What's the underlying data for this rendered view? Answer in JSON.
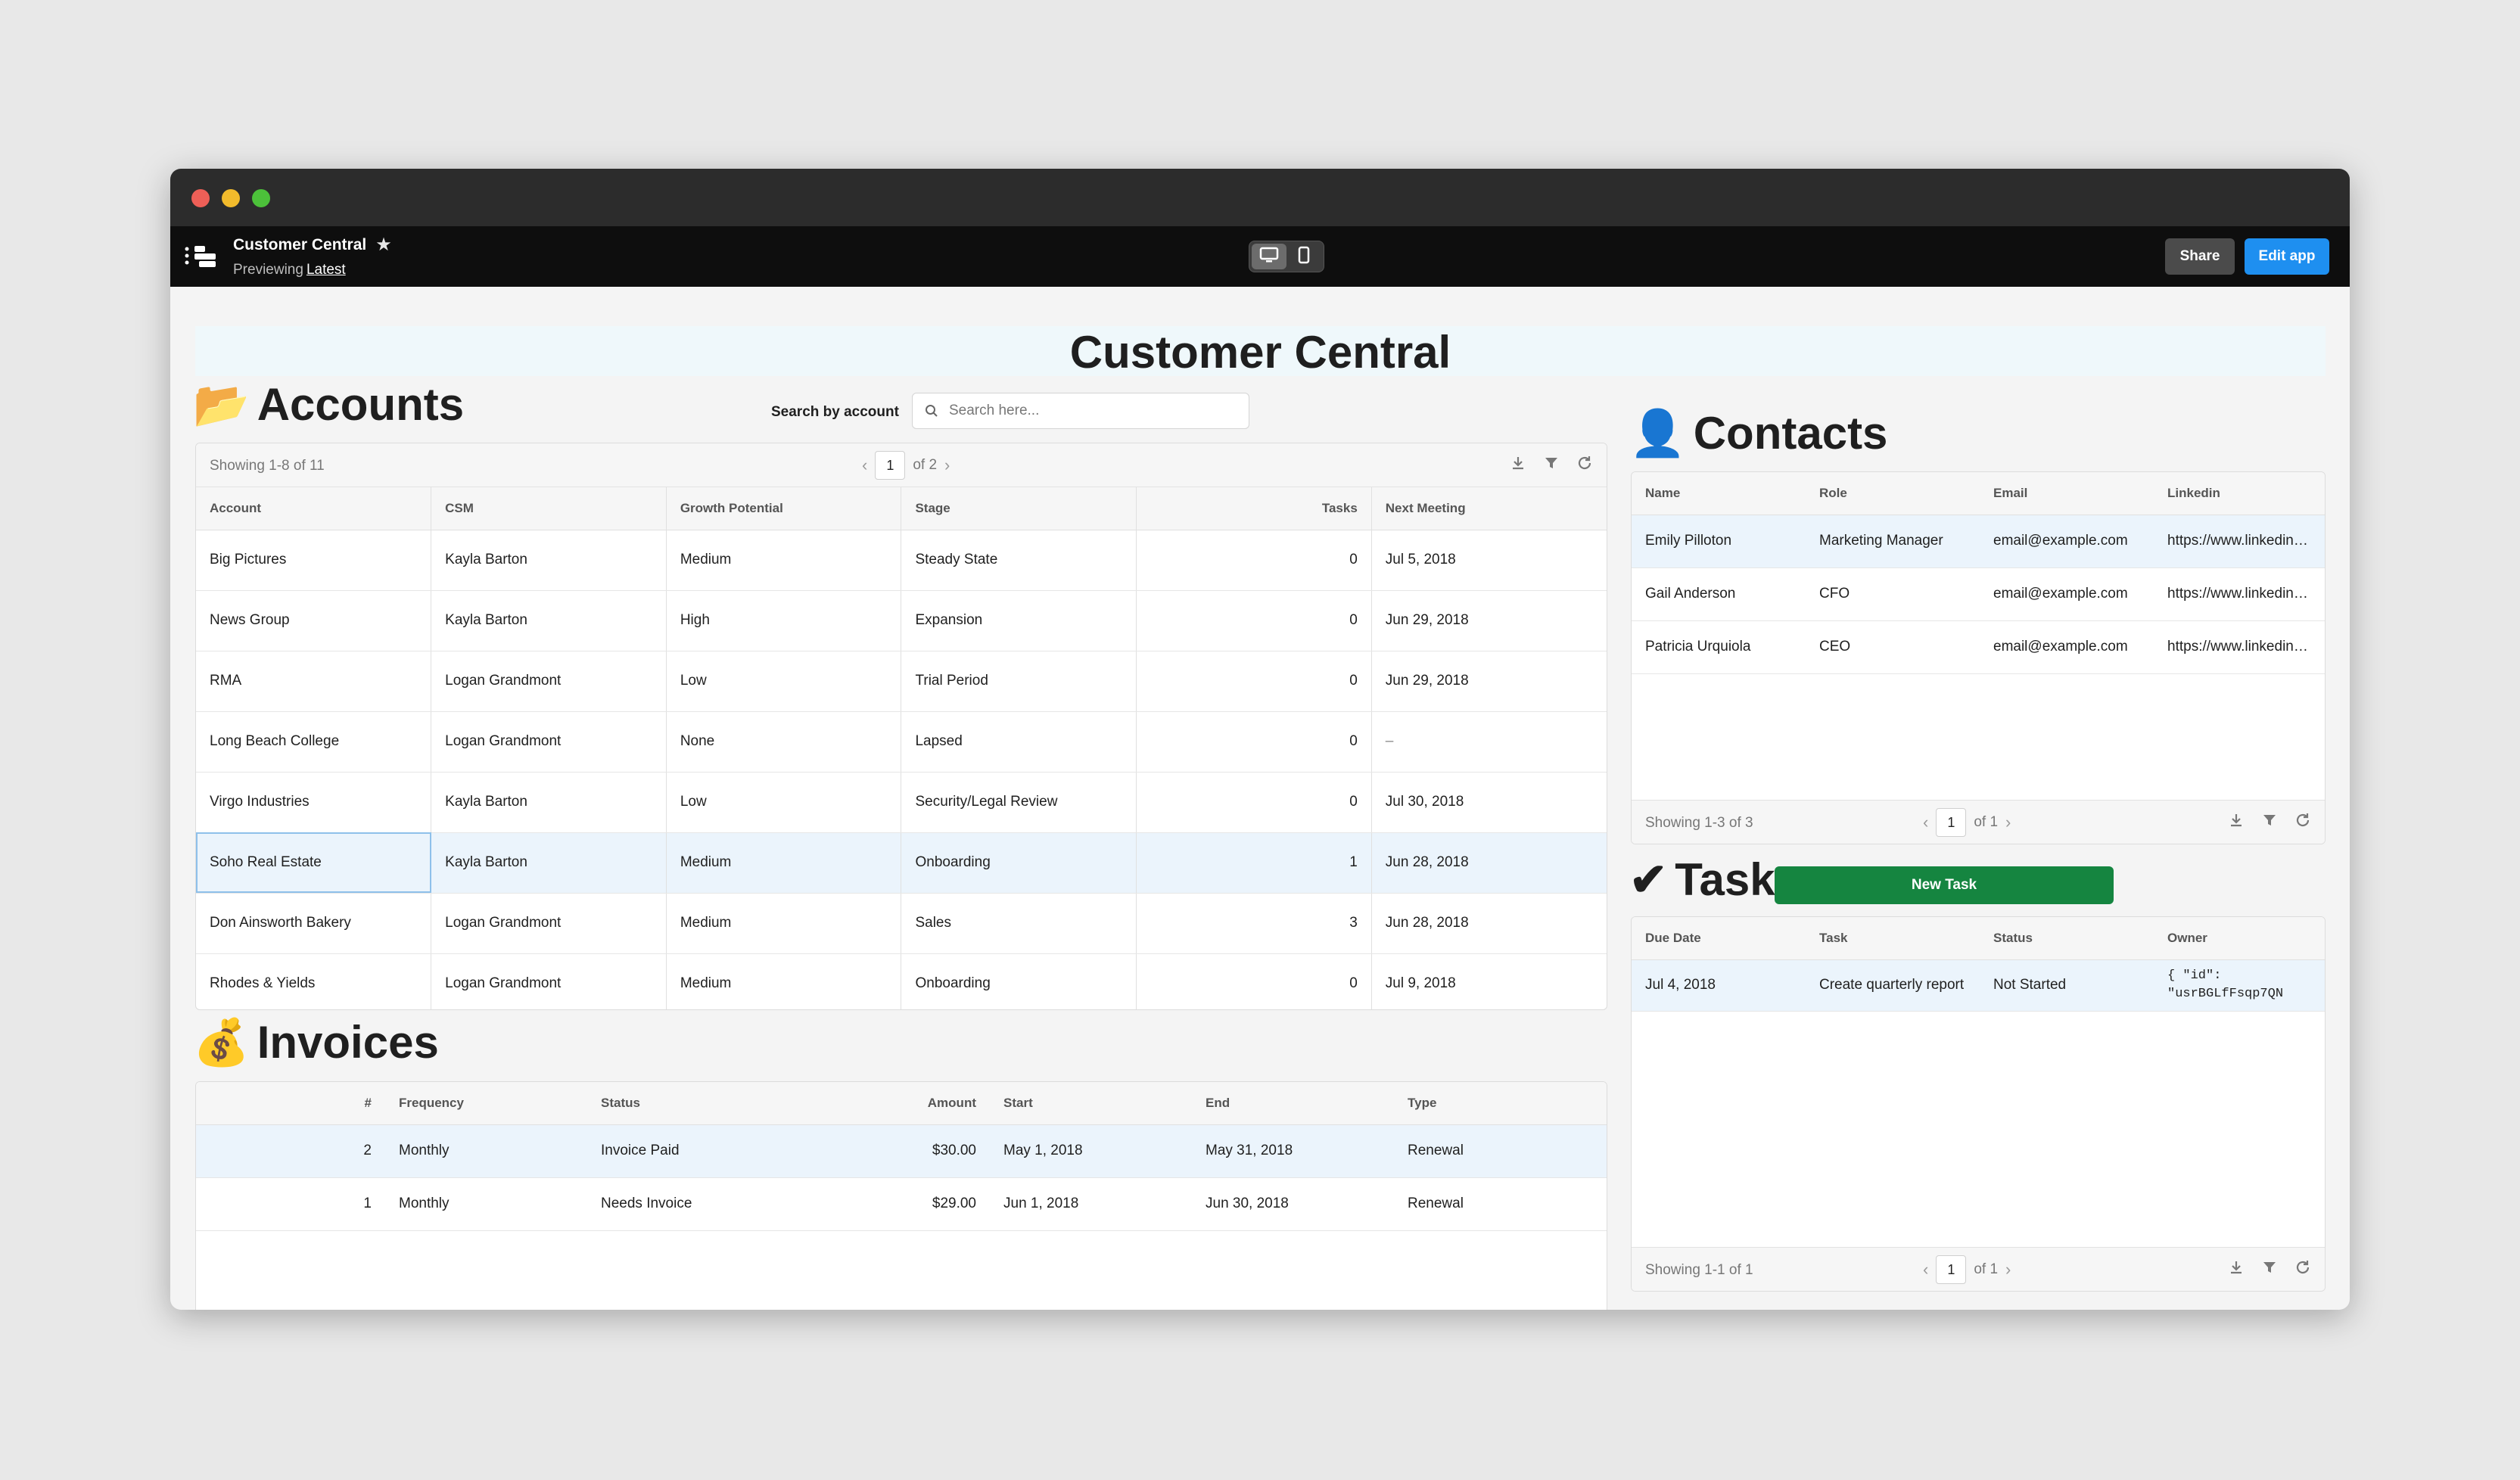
{
  "app": {
    "name": "Customer Central",
    "preview_prefix": "Previewing",
    "preview_version": "Latest",
    "share_label": "Share",
    "edit_label": "Edit app"
  },
  "page": {
    "title": "Customer Central"
  },
  "accounts": {
    "emoji": "📂",
    "heading": "Accounts",
    "search_label": "Search by account",
    "search_placeholder": "Search here...",
    "showing": "Showing 1-8 of 11",
    "page": "1",
    "page_total": "of 2",
    "columns": [
      "Account",
      "CSM",
      "Growth Potential",
      "Stage",
      "Tasks",
      "Next Meeting"
    ],
    "rows": [
      [
        "Big Pictures",
        "Kayla Barton",
        "Medium",
        "Steady State",
        "0",
        "Jul 5, 2018"
      ],
      [
        "News Group",
        "Kayla Barton",
        "High",
        "Expansion",
        "0",
        "Jun 29, 2018"
      ],
      [
        "RMA",
        "Logan Grandmont",
        "Low",
        "Trial Period",
        "0",
        "Jun 29, 2018"
      ],
      [
        "Long Beach College",
        "Logan Grandmont",
        "None",
        "Lapsed",
        "0",
        "–"
      ],
      [
        "Virgo Industries",
        "Kayla Barton",
        "Low",
        "Security/Legal Review",
        "0",
        "Jul 30, 2018"
      ],
      [
        "Soho Real Estate",
        "Kayla Barton",
        "Medium",
        "Onboarding",
        "1",
        "Jun 28, 2018"
      ],
      [
        "Don Ainsworth Bakery",
        "Logan Grandmont",
        "Medium",
        "Sales",
        "3",
        "Jun 28, 2018"
      ],
      [
        "Rhodes & Yields",
        "Logan Grandmont",
        "Medium",
        "Onboarding",
        "0",
        "Jul 9, 2018"
      ]
    ]
  },
  "invoices": {
    "emoji": "💰",
    "heading": "Invoices",
    "columns": [
      "#",
      "Frequency",
      "Status",
      "Amount",
      "Start",
      "End",
      "Type"
    ],
    "rows": [
      [
        "2",
        "Monthly",
        "Invoice Paid",
        "$30.00",
        "May 1, 2018",
        "May 31, 2018",
        "Renewal"
      ],
      [
        "1",
        "Monthly",
        "Needs Invoice",
        "$29.00",
        "Jun 1, 2018",
        "Jun 30, 2018",
        "Renewal"
      ]
    ]
  },
  "contacts": {
    "emoji": "👤",
    "heading": "Contacts",
    "columns": [
      "Name",
      "Role",
      "Email",
      "Linkedin"
    ],
    "rows": [
      [
        "Emily Pilloton",
        "Marketing Manager",
        "email@example.com",
        "https://www.linkedin.com/"
      ],
      [
        "Gail Anderson",
        "CFO",
        "email@example.com",
        "https://www.linkedin.com/"
      ],
      [
        "Patricia Urquiola",
        "CEO",
        "email@example.com",
        "https://www.linkedin.com/"
      ]
    ],
    "showing": "Showing 1-3 of 3",
    "page": "1",
    "page_total": "of 1"
  },
  "tasks": {
    "emoji": "✔",
    "heading": "Tasks",
    "new_task_label": "New Task",
    "columns": [
      "Due Date",
      "Task",
      "Status",
      "Owner"
    ],
    "rows": [
      {
        "due": "Jul 4, 2018",
        "task": "Create quarterly report",
        "status": "Not Started",
        "owner_line1": "{ \"id\":",
        "owner_line2": "\"usrBGLfFsqp7QN"
      }
    ],
    "showing": "Showing 1-1 of 1",
    "page": "1",
    "page_total": "of 1"
  },
  "icons": [
    "menu-icon",
    "star-icon",
    "desktop-icon",
    "mobile-icon",
    "search-icon",
    "download-icon",
    "filter-icon",
    "refresh-icon",
    "chevron-left-icon",
    "chevron-right-icon"
  ],
  "colors": {
    "primary": "#1e8ff0",
    "new_task": "#158540",
    "selected_row": "#ebf4fc",
    "appbar": "#0e0e0e"
  }
}
